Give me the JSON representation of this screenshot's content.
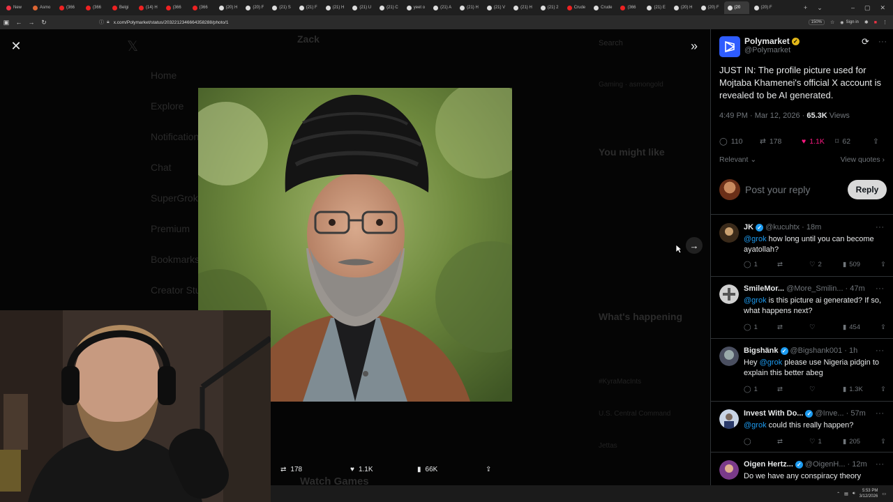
{
  "browser": {
    "tabs": [
      {
        "label": "New",
        "color": "#e34"
      },
      {
        "label": "Asmo",
        "color": "#d63"
      },
      {
        "label": "(366",
        "color": "#e22"
      },
      {
        "label": "(366",
        "color": "#e22"
      },
      {
        "label": "Belgi",
        "color": "#e22"
      },
      {
        "label": "(14) H",
        "color": "#e22"
      },
      {
        "label": "(366",
        "color": "#e22"
      },
      {
        "label": "(366",
        "color": "#e22"
      },
      {
        "label": "(20) H",
        "color": "#ddd"
      },
      {
        "label": "(20) F",
        "color": "#ddd"
      },
      {
        "label": "(21) S",
        "color": "#ddd"
      },
      {
        "label": "(21) F",
        "color": "#ddd"
      },
      {
        "label": "(21) H",
        "color": "#ddd"
      },
      {
        "label": "(21) U",
        "color": "#ddd"
      },
      {
        "label": "(21) C",
        "color": "#ddd"
      },
      {
        "label": "yeet o",
        "color": "#ddd"
      },
      {
        "label": "(21) A",
        "color": "#ddd"
      },
      {
        "label": "(21) H",
        "color": "#ddd"
      },
      {
        "label": "(21) V",
        "color": "#ddd"
      },
      {
        "label": "(21) H",
        "color": "#ddd"
      },
      {
        "label": "(21) 2",
        "color": "#ddd"
      },
      {
        "label": "Crude",
        "color": "#e22"
      },
      {
        "label": "Crude",
        "color": "#ddd"
      },
      {
        "label": "(366",
        "color": "#e22"
      },
      {
        "label": "(21) E",
        "color": "#ddd"
      },
      {
        "label": "(20) H",
        "color": "#ddd"
      },
      {
        "label": "(20) F",
        "color": "#ddd"
      },
      {
        "label": "(20",
        "color": "#ddd",
        "active": true
      },
      {
        "label": "(20) F",
        "color": "#ddd"
      }
    ],
    "url": "x.com/Polymarket/status/2032212346664358288/photo/1",
    "zoom": "150%",
    "signin": "Sign in"
  },
  "background": {
    "profile_name": "Zack",
    "nav": [
      "Home",
      "Explore",
      "Notifications",
      "Chat",
      "SuperGrok",
      "Premium",
      "Bookmarks",
      "Creator Studio"
    ],
    "search": "Search",
    "you_might_like": "You might like",
    "whats_happening": "What's happening",
    "trend1": "#KyraMacInts",
    "trend2": "U.S. Central Command",
    "trend3": "Jettas",
    "game": "Watch Games",
    "gaming": "Gaming · asmongold"
  },
  "media_actions": {
    "retweets": "178",
    "likes": "1.1K",
    "views": "66K"
  },
  "tweet": {
    "name": "Polymarket",
    "handle": "@Polymarket",
    "text": "JUST IN: The profile picture used for Mojtaba Khamenei's official X account is revealed to be AI generated.",
    "time": "4:49 PM · Mar 12, 2026 · ",
    "views_count": "65.3K",
    "views_label": " Views",
    "replies": "110",
    "retweets": "178",
    "likes": "1.1K",
    "bookmarks": "62",
    "sort": "Relevant",
    "quotes": "View quotes",
    "reply_placeholder": "Post your reply",
    "reply_button": "Reply"
  },
  "replies": [
    {
      "name": "JK",
      "handle": "@kucuhtx",
      "time": "· 18m",
      "mention": "@grok",
      "text": " how long until you can become ayatollah?",
      "replies": "1",
      "retweets": "",
      "likes": "2",
      "views": "509",
      "avatar": "#3a2a1a",
      "verified": true
    },
    {
      "name": "SmileMor...",
      "handle": "@More_Smilin...",
      "time": "· 47m",
      "mention": "@grok",
      "text": " is this picture ai generated? If so, what happens next?",
      "replies": "1",
      "retweets": "",
      "likes": "",
      "views": "454",
      "avatar": "#d0d0d0",
      "verified": false
    },
    {
      "name": "Bigshänk",
      "handle": "@Bigshank001",
      "time": "· 1h",
      "mention_pre": "Hey ",
      "mention": "@grok",
      "text": " please use Nigeria pidgin to explain this better abeg",
      "replies": "1",
      "retweets": "",
      "likes": "",
      "views": "1.3K",
      "avatar": "#556",
      "verified": true
    },
    {
      "name": "Invest With Do...",
      "handle": "@Inve...",
      "time": "· 57m",
      "mention": "@grok",
      "text": " could this really happen?",
      "replies": "",
      "retweets": "",
      "likes": "1",
      "views": "205",
      "avatar": "#8aa4c8",
      "verified": true
    },
    {
      "name": "Oigen Hertz...",
      "handle": "@OigenH...",
      "time": "· 12m",
      "mention": "",
      "text": "Do we have any conspiracy theory",
      "replies": "",
      "retweets": "",
      "likes": "",
      "views": "",
      "avatar": "#7a3a8a",
      "verified": true
    }
  ],
  "taskbar": {
    "time": "5:53 PM",
    "date": "3/12/2026"
  }
}
